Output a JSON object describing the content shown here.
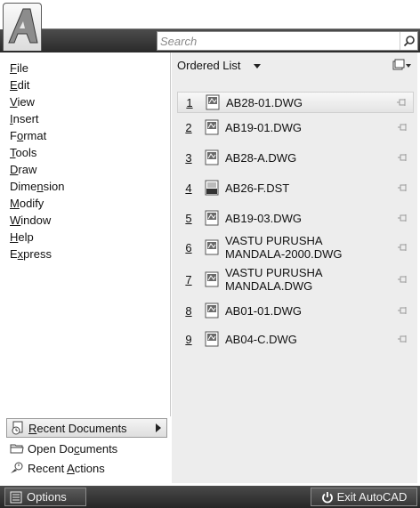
{
  "search": {
    "placeholder": "Search"
  },
  "menu": [
    {
      "label": "File",
      "ul": "F",
      "rest": "ile"
    },
    {
      "label": "Edit",
      "ul": "E",
      "rest": "dit"
    },
    {
      "label": "View",
      "ul": "V",
      "rest": "iew"
    },
    {
      "label": "Insert",
      "ul": "I",
      "rest": "nsert"
    },
    {
      "label": "Format",
      "pre": "F",
      "ul": "o",
      "rest": "rmat"
    },
    {
      "label": "Tools",
      "ul": "T",
      "rest": "ools"
    },
    {
      "label": "Draw",
      "ul": "D",
      "rest": "raw"
    },
    {
      "label": "Dimension",
      "pre": "Dime",
      "ul": "n",
      "rest": "sion"
    },
    {
      "label": "Modify",
      "ul": "M",
      "rest": "odify"
    },
    {
      "label": "Window",
      "ul": "W",
      "rest": "indow"
    },
    {
      "label": "Help",
      "ul": "H",
      "rest": "elp"
    },
    {
      "label": "Express",
      "pre": "E",
      "ul": "x",
      "rest": "press"
    }
  ],
  "bottom_menu": {
    "recent_documents": {
      "label": "Recent Documents",
      "ul": "R",
      "rest": "ecent Documents"
    },
    "open_documents": {
      "label": "Open Documents",
      "pre": "Open Do",
      "ul": "c",
      "rest": "uments"
    },
    "recent_actions": {
      "label": "Recent Actions",
      "pre": "Recent ",
      "ul": "A",
      "rest": "ctions"
    }
  },
  "list": {
    "sort_label": "Ordered List",
    "files": [
      {
        "num": "1",
        "name": "AB28-01.DWG",
        "type": "dwg"
      },
      {
        "num": "2",
        "name": "AB19-01.DWG",
        "type": "dwg"
      },
      {
        "num": "3",
        "name": "AB28-A.DWG",
        "type": "dwg"
      },
      {
        "num": "4",
        "name": "AB26-F.DST",
        "type": "dst"
      },
      {
        "num": "5",
        "name": "AB19-03.DWG",
        "type": "dwg"
      },
      {
        "num": "6",
        "name": "VASTU PURUSHA MANDALA-2000.DWG",
        "line1": "VASTU PURUSHA",
        "line2": "MANDALA-2000.DWG",
        "type": "dwg"
      },
      {
        "num": "7",
        "name": "VASTU PURUSHA MANDALA.DWG",
        "line1": "VASTU PURUSHA",
        "line2": "MANDALA.DWG",
        "type": "dwg"
      },
      {
        "num": "8",
        "name": "AB01-01.DWG",
        "type": "dwg"
      },
      {
        "num": "9",
        "name": "AB04-C.DWG",
        "type": "dwg"
      }
    ]
  },
  "footer": {
    "options_label": "Options",
    "exit_label": "Exit AutoCAD"
  }
}
